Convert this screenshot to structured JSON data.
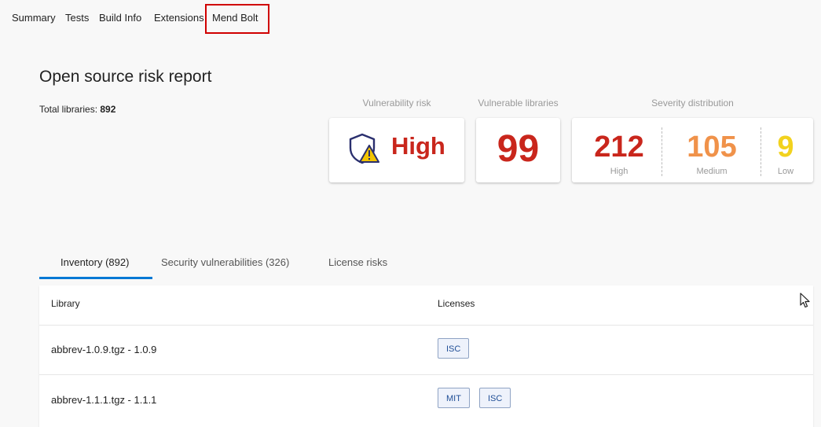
{
  "top_tabs": [
    "Summary",
    "Tests",
    "Build Info",
    "Extensions",
    "Mend Bolt"
  ],
  "active_tab": "Mend Bolt",
  "report": {
    "title": "Open source risk report",
    "total_label": "Total libraries:",
    "total_value": "892"
  },
  "metrics": {
    "vulnerability_risk_label": "Vulnerability risk",
    "vulnerability_risk_value": "High",
    "vulnerable_libraries_label": "Vulnerable libraries",
    "vulnerable_libraries_value": "99",
    "severity_label": "Severity distribution",
    "severity": [
      {
        "value": "212",
        "label": "High",
        "color": "#c9261c"
      },
      {
        "value": "105",
        "label": "Medium",
        "color": "#f0924a"
      },
      {
        "value": "9",
        "label": "Low",
        "color": "#f2d21e"
      }
    ]
  },
  "sub_tabs": [
    "Inventory (892)",
    "Security vulnerabilities (326)",
    "License risks"
  ],
  "table": {
    "headers": {
      "library": "Library",
      "licenses": "Licenses"
    },
    "rows": [
      {
        "library": "abbrev-1.0.9.tgz - 1.0.9",
        "licenses": [
          "ISC"
        ]
      },
      {
        "library": "abbrev-1.1.1.tgz - 1.1.1",
        "licenses": [
          "MIT",
          "ISC"
        ]
      }
    ]
  },
  "colors": {
    "accent": "#0078d4",
    "danger": "#c9261c",
    "highlight_box": "#d00000"
  },
  "icons": {
    "risk": "shield-warning-icon",
    "cursor": "mouse-pointer-icon"
  }
}
